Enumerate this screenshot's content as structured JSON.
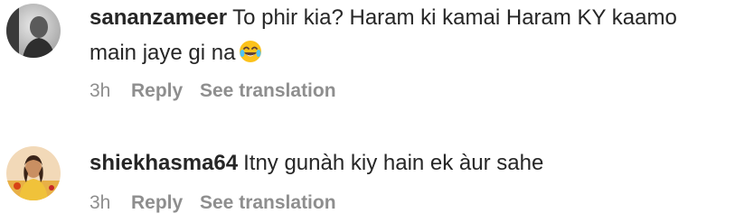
{
  "comments": [
    {
      "username": "sananzameer",
      "text": "To phir kia? Haram ki kamai Haram KY kaamo main jaye gi na",
      "emoji": "face-with-tears-of-joy",
      "time": "3h",
      "reply_label": "Reply",
      "translation_label": "See translation"
    },
    {
      "username": "shiekhasma64",
      "text": "Itny gunàh kiy hain ek àur sahe",
      "time": "3h",
      "reply_label": "Reply",
      "translation_label": "See translation"
    }
  ]
}
